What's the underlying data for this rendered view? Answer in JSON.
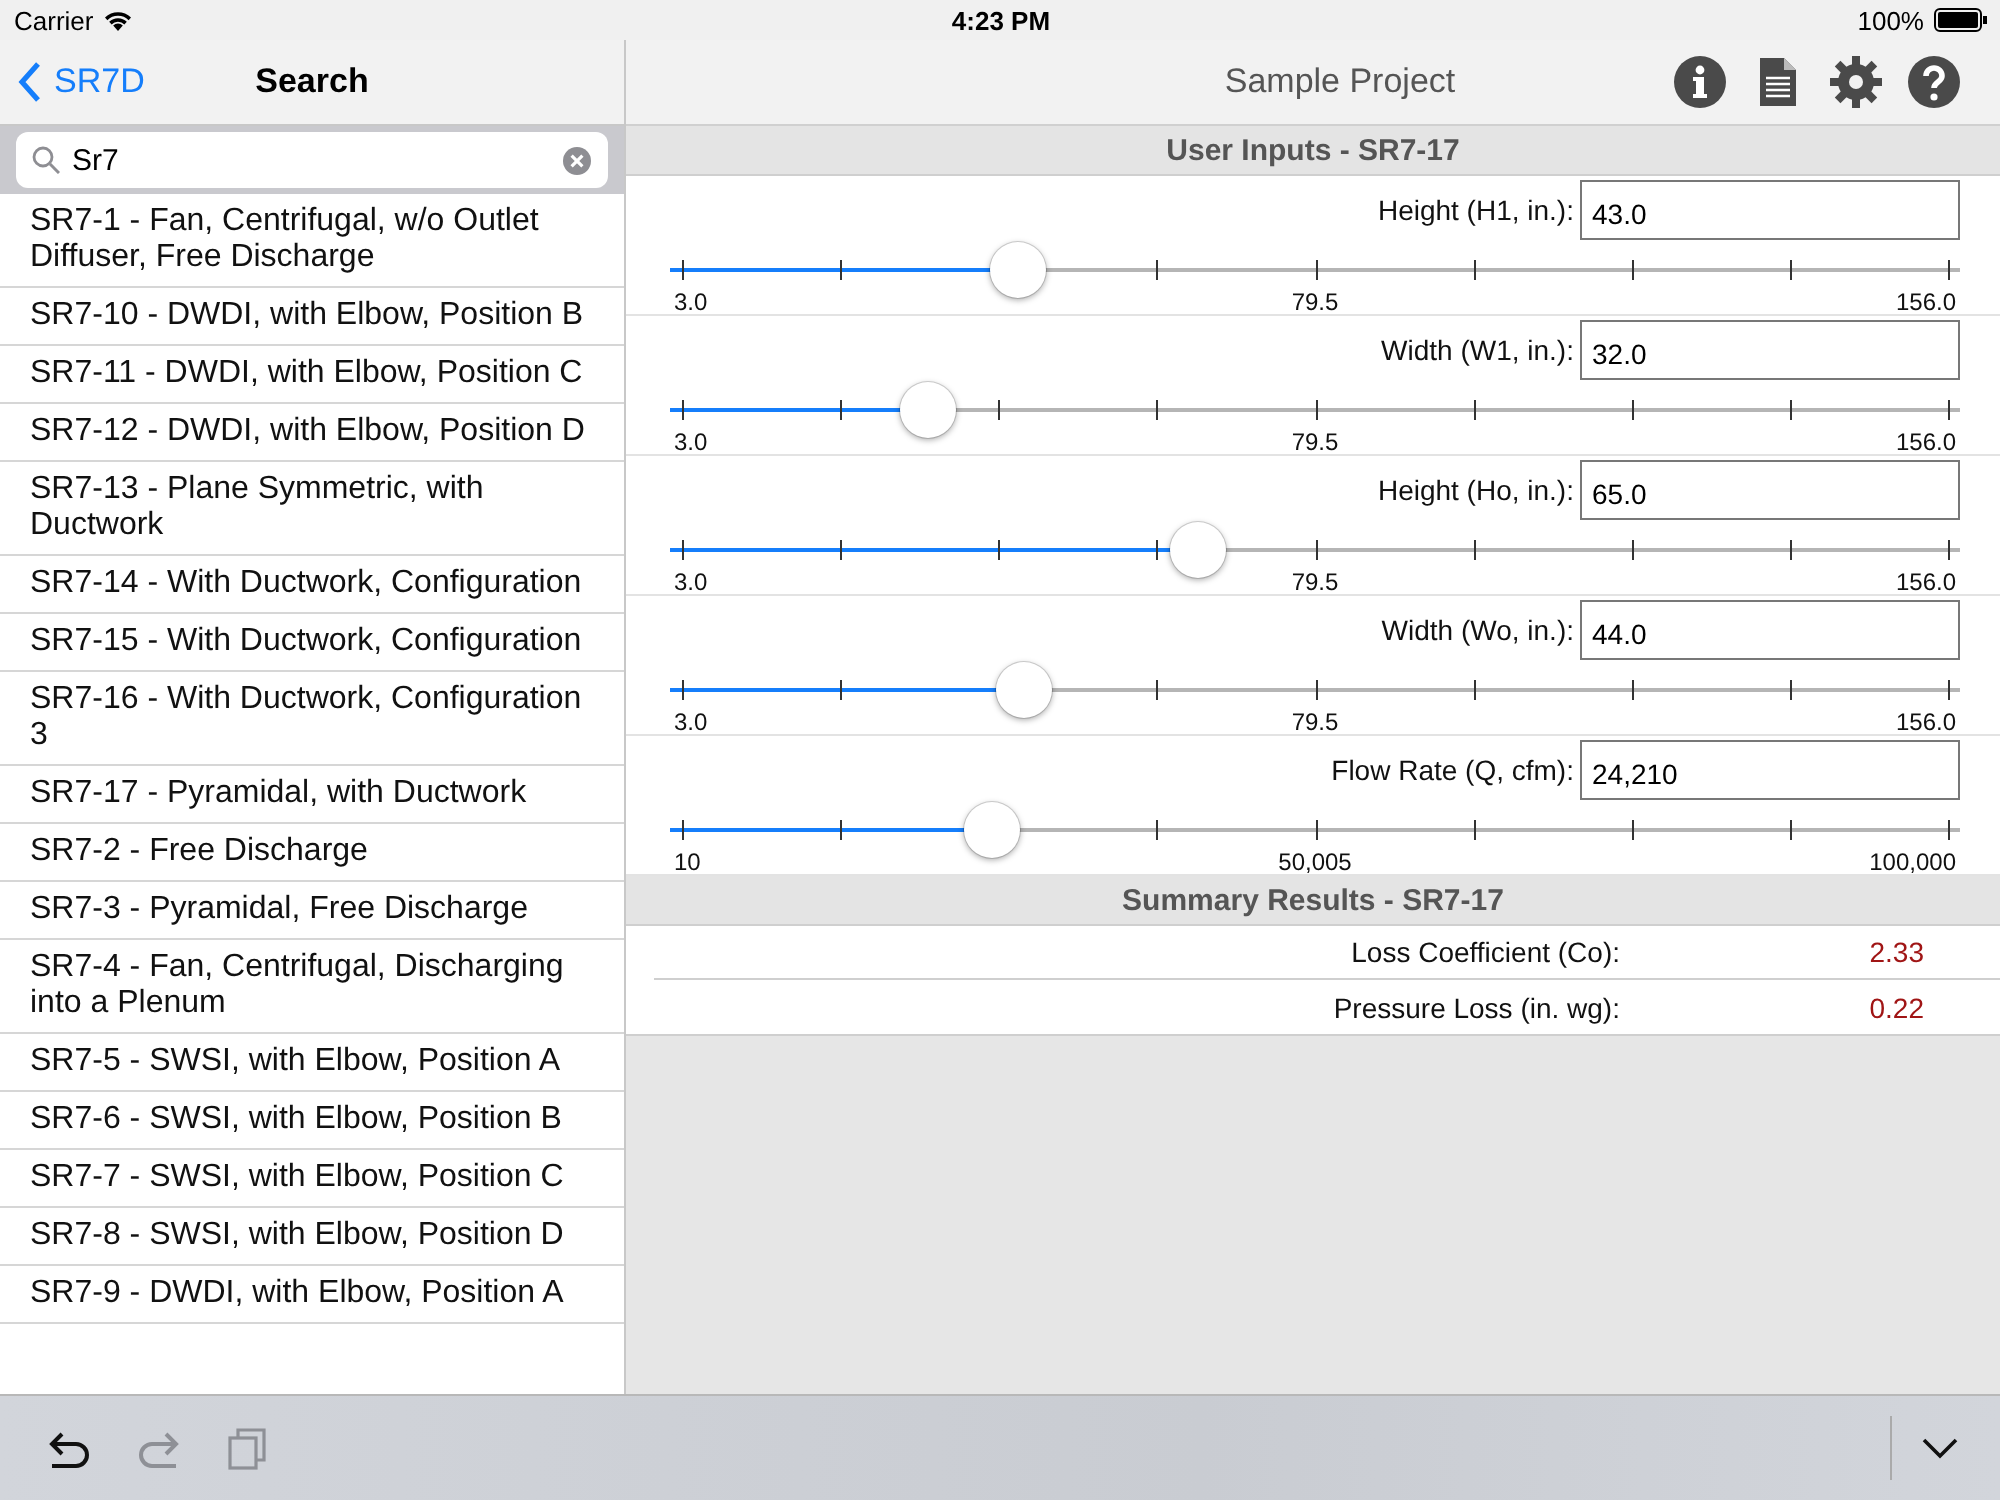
{
  "status_bar": {
    "carrier": "Carrier",
    "time": "4:23 PM",
    "battery": "100%"
  },
  "sidebar": {
    "back_label": "SR7D",
    "title": "Search",
    "search": {
      "value": "Sr7"
    },
    "items": [
      {
        "label": "SR7-1 - Fan, Centrifugal, w/o Outlet Diffuser, Free Discharge"
      },
      {
        "label": "SR7-10 - DWDI, with Elbow, Position B"
      },
      {
        "label": "SR7-11 - DWDI, with Elbow, Position C"
      },
      {
        "label": "SR7-12 - DWDI, with Elbow, Position D"
      },
      {
        "label": "SR7-13 - Plane Symmetric, with Ductwork"
      },
      {
        "label": "SR7-14 - With Ductwork, Configuration"
      },
      {
        "label": "SR7-15 - With Ductwork, Configuration"
      },
      {
        "label": "SR7-16 - With Ductwork, Configuration 3"
      },
      {
        "label": "SR7-17 - Pyramidal, with Ductwork"
      },
      {
        "label": "SR7-2 - Free Discharge"
      },
      {
        "label": "SR7-3 - Pyramidal, Free Discharge"
      },
      {
        "label": "SR7-4 - Fan, Centrifugal, Discharging into a Plenum"
      },
      {
        "label": "SR7-5 - SWSI, with Elbow, Position A"
      },
      {
        "label": "SR7-6 - SWSI, with Elbow, Position B"
      },
      {
        "label": "SR7-7 - SWSI, with Elbow, Position C"
      },
      {
        "label": "SR7-8 - SWSI, with Elbow, Position D"
      },
      {
        "label": "SR7-9 - DWDI, with Elbow, Position A"
      }
    ]
  },
  "main": {
    "title": "Sample Project",
    "inputs_header": "User Inputs - SR7-17",
    "inputs": [
      {
        "label": "Height (H1, in.):",
        "value": "43.0",
        "level": 0.27,
        "min": "3.0",
        "mid": "79.5",
        "max": "156.0"
      },
      {
        "label": "Width (W1, in.):",
        "value": "32.0",
        "level": 0.2,
        "min": "3.0",
        "mid": "79.5",
        "max": "156.0"
      },
      {
        "label": "Height (Ho, in.):",
        "value": "65.0",
        "level": 0.41,
        "min": "3.0",
        "mid": "79.5",
        "max": "156.0"
      },
      {
        "label": "Width (Wo, in.):",
        "value": "44.0",
        "level": 0.275,
        "min": "3.0",
        "mid": "79.5",
        "max": "156.0"
      },
      {
        "label": "Flow Rate (Q, cfm):",
        "value": "24,210",
        "level": 0.25,
        "min": "10",
        "mid": "50,005",
        "max": "100,000"
      }
    ],
    "summary_header": "Summary Results - SR7-17",
    "results": [
      {
        "label": "Loss Coefficient (Co):",
        "value": "2.33"
      },
      {
        "label": "Pressure Loss (in. wg):",
        "value": "0.22"
      }
    ]
  },
  "toolbar": {
    "buttons": [
      {
        "kind": "undo",
        "disabled": false
      },
      {
        "kind": "redo",
        "disabled": true
      },
      {
        "kind": "copy",
        "disabled": true
      }
    ]
  }
}
